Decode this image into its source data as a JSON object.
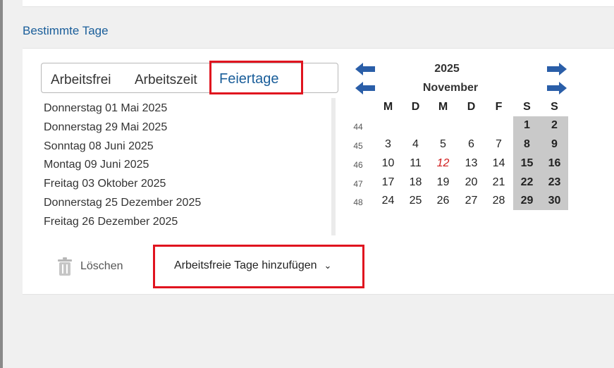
{
  "section": {
    "title": "Bestimmte Tage"
  },
  "tabs": [
    {
      "label": "Arbeitsfrei",
      "active": false
    },
    {
      "label": "Arbeitszeit",
      "active": false
    },
    {
      "label": "Feiertage",
      "active": true
    }
  ],
  "holidays": [
    "Donnerstag 01 Mai 2025",
    "Donnerstag 29 Mai 2025",
    "Sonntag 08 Juni 2025",
    "Montag 09 Juni 2025",
    "Freitag 03 Oktober 2025",
    "Donnerstag 25 Dezember 2025",
    "Freitag 26 Dezember 2025"
  ],
  "calendar": {
    "year": "2025",
    "month": "November",
    "weekdays": [
      "M",
      "D",
      "M",
      "D",
      "F",
      "S",
      "S"
    ],
    "weeks": [
      {
        "num": "44",
        "days": [
          "",
          "",
          "",
          "",
          "",
          "1",
          "2"
        ]
      },
      {
        "num": "45",
        "days": [
          "3",
          "4",
          "5",
          "6",
          "7",
          "8",
          "9"
        ]
      },
      {
        "num": "46",
        "days": [
          "10",
          "11",
          "12",
          "13",
          "14",
          "15",
          "16"
        ]
      },
      {
        "num": "47",
        "days": [
          "17",
          "18",
          "19",
          "20",
          "21",
          "22",
          "23"
        ]
      },
      {
        "num": "48",
        "days": [
          "24",
          "25",
          "26",
          "27",
          "28",
          "29",
          "30"
        ]
      }
    ],
    "holiday_day": "12"
  },
  "actions": {
    "delete_label": "Löschen",
    "add_label": "Arbeitsfreie Tage hinzufügen"
  },
  "colors": {
    "accent": "#1a5e9a",
    "highlight": "#e0141f",
    "weekend": "#c9c9c9",
    "arrow": "#2a5ea8"
  },
  "icons": {
    "prev": "arrow-left-icon",
    "next": "arrow-right-icon",
    "delete": "trash-icon",
    "dropdown": "chevron-down-icon"
  }
}
